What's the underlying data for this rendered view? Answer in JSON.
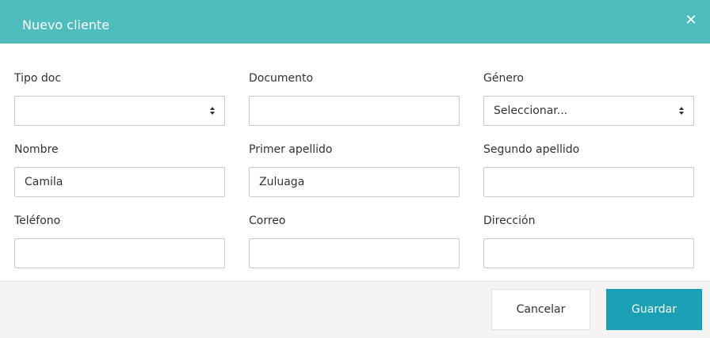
{
  "modal": {
    "title": "Nuevo cliente",
    "close_icon": "close-icon"
  },
  "form": {
    "tipo_doc": {
      "label": "Tipo doc",
      "value": ""
    },
    "documento": {
      "label": "Documento",
      "value": ""
    },
    "genero": {
      "label": "Género",
      "value": "Seleccionar..."
    },
    "nombre": {
      "label": "Nombre",
      "value": "Camila"
    },
    "primer_apellido": {
      "label": "Primer apellido",
      "value": "Zuluaga"
    },
    "segundo_apellido": {
      "label": "Segundo apellido",
      "value": ""
    },
    "telefono": {
      "label": "Teléfono",
      "value": ""
    },
    "correo": {
      "label": "Correo",
      "value": ""
    },
    "direccion": {
      "label": "Dirección",
      "value": ""
    }
  },
  "footer": {
    "cancel_label": "Cancelar",
    "save_label": "Guardar"
  },
  "colors": {
    "header": "#4fbcbd",
    "primary_button": "#1a9fb5",
    "footer_bg": "#f4f4f4"
  }
}
